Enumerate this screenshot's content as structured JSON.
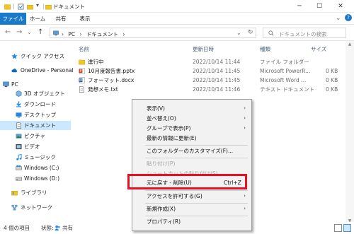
{
  "window": {
    "title": "ドキュメント",
    "controls": {
      "minimize": "─",
      "maximize": "☐",
      "close": "✕"
    },
    "quick_access_sep": "|",
    "quick_access_dropdown": "▾"
  },
  "ribbon": {
    "tabs": [
      "ファイル",
      "ホーム",
      "共有",
      "表示"
    ],
    "collapse_icon": "⌄",
    "help_icon": "?"
  },
  "navigation": {
    "back": "←",
    "forward": "→",
    "recent": "⌄",
    "up": "↑",
    "breadcrumb": {
      "sep": "›",
      "items": [
        "PC",
        "ドキュメント"
      ]
    },
    "address_dropdown": "⌄",
    "refresh": "↻",
    "search_placeholder": "ドキュメントの検索"
  },
  "sidebar": {
    "items": [
      {
        "label": "クイック アクセス",
        "icon": "star-icon"
      },
      {
        "label": "OneDrive - Personal",
        "icon": "cloud-icon"
      },
      {
        "label": "PC",
        "icon": "pc-icon"
      },
      {
        "label": "3D オブジェクト",
        "icon": "cube-icon"
      },
      {
        "label": "ダウンロード",
        "icon": "download-icon"
      },
      {
        "label": "デスクトップ",
        "icon": "desktop-icon"
      },
      {
        "label": "ドキュメント",
        "icon": "document-icon",
        "selected": true
      },
      {
        "label": "ピクチャ",
        "icon": "picture-icon"
      },
      {
        "label": "ビデオ",
        "icon": "video-icon"
      },
      {
        "label": "ミュージック",
        "icon": "music-icon"
      },
      {
        "label": "Windows (C:)",
        "icon": "drive-icon"
      },
      {
        "label": "Windows (D:)",
        "icon": "drive-icon"
      },
      {
        "label": "ライブラリ",
        "icon": "library-icon"
      },
      {
        "label": "ネットワーク",
        "icon": "network-icon"
      }
    ]
  },
  "file_list": {
    "columns": {
      "name": "名前",
      "modified": "更新日時",
      "type": "種類",
      "size": "サイズ"
    },
    "rows": [
      {
        "name": "進行中",
        "modified": "2022/10/14 11:44",
        "type": "ファイル フォルダー",
        "size": "",
        "icon": "folder-icon"
      },
      {
        "name": "10月度報告書.pptx",
        "modified": "2022/10/14 11:45",
        "type": "Microsoft PowerR...",
        "size": "0 KB",
        "icon": "powerpoint-icon"
      },
      {
        "name": "フォーマット.docx",
        "modified": "2022/10/14 11:45",
        "type": "Microsoft Word ...",
        "size": "0 KB",
        "icon": "word-icon"
      },
      {
        "name": "発想メモ.txt",
        "modified": "2022/10/14 11:46",
        "type": "テキスト ドキュメント",
        "size": "0 KB",
        "icon": "text-file-icon"
      }
    ]
  },
  "status_bar": {
    "item_count": "4 個の項目",
    "state_label": "状態:",
    "share_label": "共有"
  },
  "context_menu": {
    "submenu_arrow": "›",
    "items": [
      {
        "label": "表示(V)",
        "submenu": true
      },
      {
        "label": "並べ替え(O)",
        "submenu": true
      },
      {
        "label": "グループで表示(P)",
        "submenu": true
      },
      {
        "label": "最新の情報に更新(E)"
      },
      {
        "label": "このフォルダーのカスタマイズ(F)..."
      },
      {
        "label": "貼り付け(P)",
        "disabled": true
      },
      {
        "label": "ショートカットの貼り付け(S)",
        "disabled": true
      },
      {
        "label": "元に戻す - 削除(U)",
        "accelerator": "Ctrl+Z",
        "highlighted": true
      },
      {
        "label": "アクセスを許可する(G)",
        "submenu": true
      },
      {
        "label": "新規作成(X)",
        "submenu": true
      },
      {
        "label": "プロパティ(R)"
      }
    ]
  },
  "colors": {
    "accent": "#1979ca",
    "selection": "#cce8ff",
    "highlight_box": "#e81123",
    "folder": "#f3c623"
  }
}
